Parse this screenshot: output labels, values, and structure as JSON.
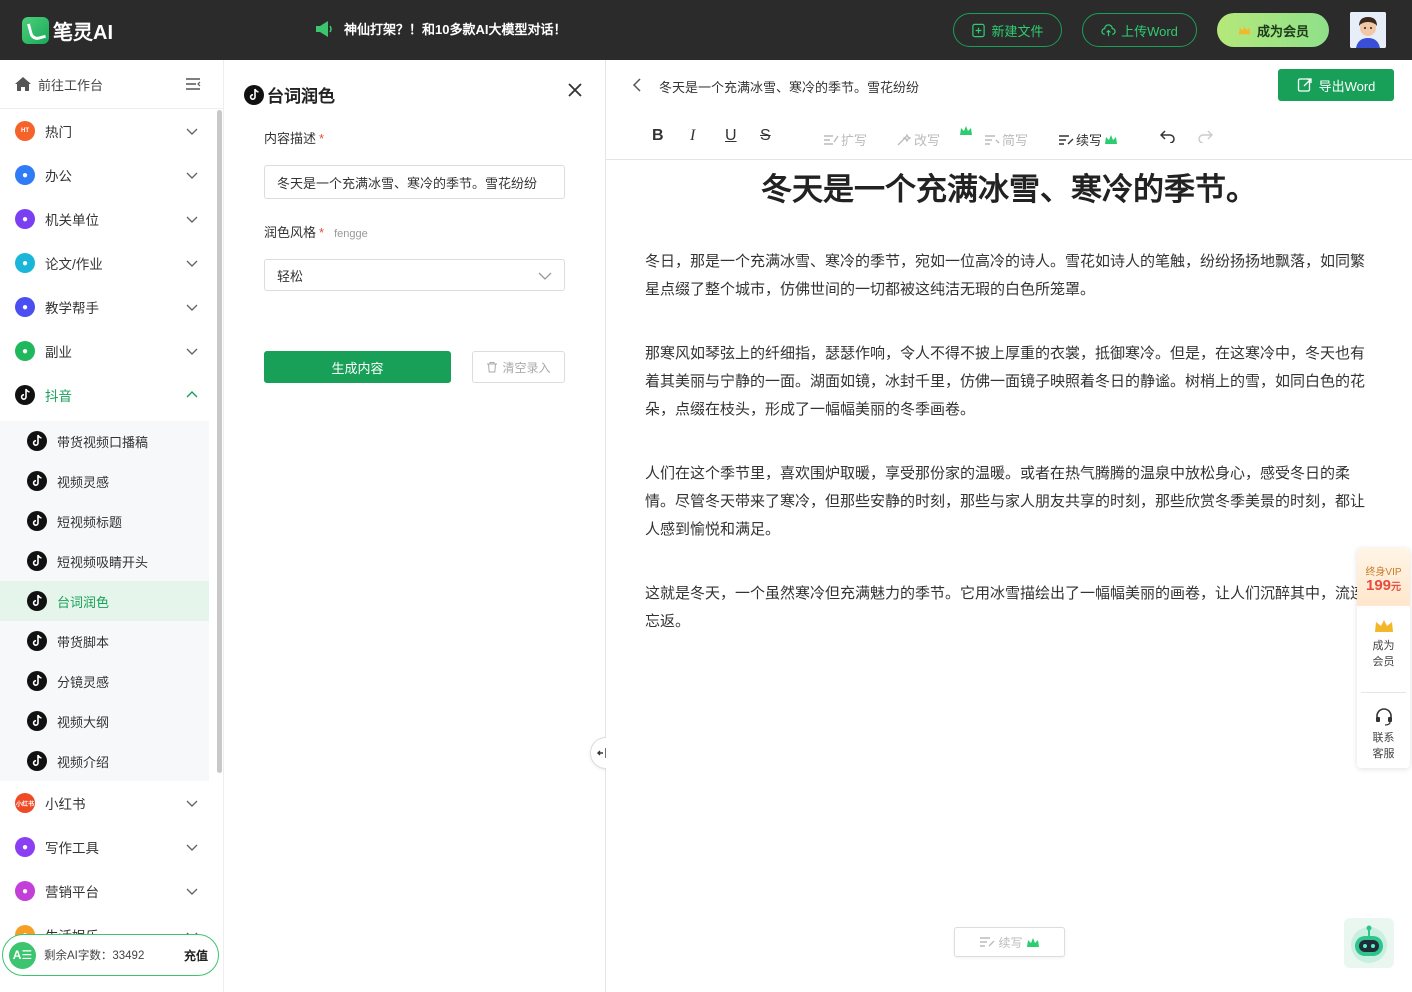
{
  "app": {
    "name": "笔灵AI"
  },
  "announce": {
    "text": "神仙打架？！和10多款AI大模型对话！"
  },
  "topbar": {
    "new_file": "新建文件",
    "upload_word": "上传Word",
    "member": "成为会员"
  },
  "sidebar": {
    "workspace": "前往工作台",
    "items": [
      {
        "label": "热门",
        "icon": "hot-icon",
        "color": "#f5632a"
      },
      {
        "label": "办公",
        "icon": "office-icon",
        "color": "#2f7cf6"
      },
      {
        "label": "机关单位",
        "icon": "gov-icon",
        "color": "#7a3ff2"
      },
      {
        "label": "论文/作业",
        "icon": "paper-icon",
        "color": "#1ab6d9"
      },
      {
        "label": "教学帮手",
        "icon": "teach-icon",
        "color": "#4b4ef0"
      },
      {
        "label": "副业",
        "icon": "side-job-icon",
        "color": "#20b85c"
      },
      {
        "label": "抖音",
        "icon": "douyin-icon",
        "color": "#111111"
      },
      {
        "label": "小红书",
        "icon": "xiaohongshu-icon",
        "color": "#f04a24"
      },
      {
        "label": "写作工具",
        "icon": "writing-tool-icon",
        "color": "#8a3ff2"
      },
      {
        "label": "营销平台",
        "icon": "marketing-icon",
        "color": "#c23fd8"
      },
      {
        "label": "生活娱乐",
        "icon": "life-icon",
        "color": "#f5a024"
      }
    ],
    "douyin_sub": [
      "带货视频口播稿",
      "视频灵感",
      "短视频标题",
      "短视频吸睛开头",
      "台词润色",
      "带货脚本",
      "分镜灵感",
      "视频大纲",
      "视频介绍"
    ],
    "quota_label": "剩余AI字数：33492",
    "recharge": "充值"
  },
  "form": {
    "title": "台词润色",
    "desc_label": "内容描述",
    "desc_value": "冬天是一个充满冰雪、寒冷的季节。雪花纷纷",
    "style_label": "润色风格",
    "style_hint": "fengge",
    "style_value": "轻松",
    "generate": "生成内容",
    "clear": "清空录入"
  },
  "editor": {
    "doc_title": "冬天是一个充满冰雪、寒冷的季节。雪花纷纷",
    "export": "导出Word",
    "tools": {
      "bold": "B",
      "italic": "I",
      "underline": "U",
      "strike": "S",
      "expand": "扩写",
      "rewrite": "改写",
      "shorten": "简写",
      "continue": "续写"
    },
    "heading": "冬天是一个充满冰雪、寒冷的季节。",
    "paragraphs": [
      "冬日，那是一个充满冰雪、寒冷的季节，宛如一位高冷的诗人。雪花如诗人的笔触，纷纷扬扬地飘落，如同繁星点缀了整个城市，仿佛世间的一切都被这纯洁无瑕的白色所笼罩。",
      "那寒风如琴弦上的纤细指，瑟瑟作响，令人不得不披上厚重的衣裳，抵御寒冷。但是，在这寒冷中，冬天也有着其美丽与宁静的一面。湖面如镜，冰封千里，仿佛一面镜子映照着冬日的静谧。树梢上的雪，如同白色的花朵，点缀在枝头，形成了一幅幅美丽的冬季画卷。",
      "人们在这个季节里，喜欢围炉取暖，享受那份家的温暖。或者在热气腾腾的温泉中放松身心，感受冬日的柔情。尽管冬天带来了寒冷，但那些安静的时刻，那些与家人朋友共享的时刻，那些欣赏冬季美景的时刻，都让人感到愉悦和满足。",
      "这就是冬天，一个虽然寒冷但充满魅力的季节。它用冰雪描绘出了一幅幅美丽的画卷，让人们沉醉其中，流连忘返。"
    ],
    "continue_btn": "续写"
  },
  "float": {
    "vip_line1": "终身VIP",
    "vip_price": "199",
    "vip_unit": "元",
    "member": "成为会员",
    "service": "联系客服"
  }
}
